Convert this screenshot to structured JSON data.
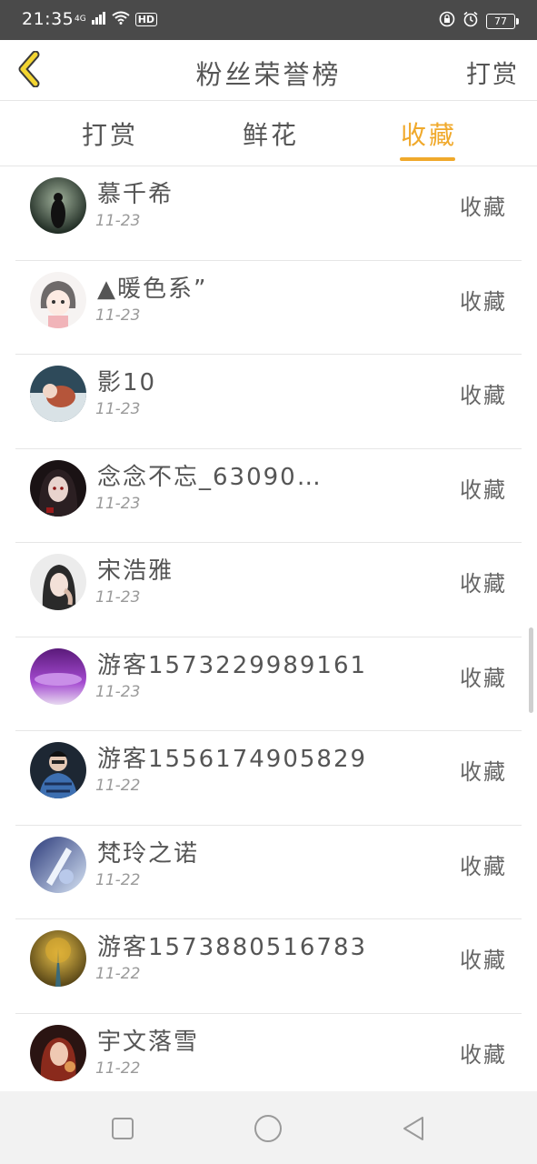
{
  "status_bar": {
    "time": "21:35",
    "network": "4G",
    "hd": "HD",
    "battery": "77"
  },
  "header": {
    "title": "粉丝荣誉榜",
    "right_button": "打赏"
  },
  "tabs": [
    {
      "label": "打赏",
      "active": false
    },
    {
      "label": "鲜花",
      "active": false
    },
    {
      "label": "收藏",
      "active": true
    }
  ],
  "colors": {
    "accent": "#f0a92b",
    "status_bar": "#4a4a4a"
  },
  "list": [
    {
      "name": "慕千希",
      "date": "11-23",
      "action": "收藏"
    },
    {
      "name": "▲暖色系”",
      "date": "11-23",
      "action": "收藏"
    },
    {
      "name": "影10",
      "date": "11-23",
      "action": "收藏"
    },
    {
      "name": "念念不忘_63090…",
      "date": "11-23",
      "action": "收藏"
    },
    {
      "name": "宋浩雅",
      "date": "11-23",
      "action": "收藏"
    },
    {
      "name": "游客15732299891​61",
      "date": "11-23",
      "action": "收藏"
    },
    {
      "name": "游客15561749058​29",
      "date": "11-22",
      "action": "收藏"
    },
    {
      "name": "梵玲之诺",
      "date": "11-22",
      "action": "收藏"
    },
    {
      "name": "游客15738805167​83",
      "date": "11-22",
      "action": "收藏"
    },
    {
      "name": "宇文落雪",
      "date": "11-22",
      "action": "收藏"
    }
  ]
}
